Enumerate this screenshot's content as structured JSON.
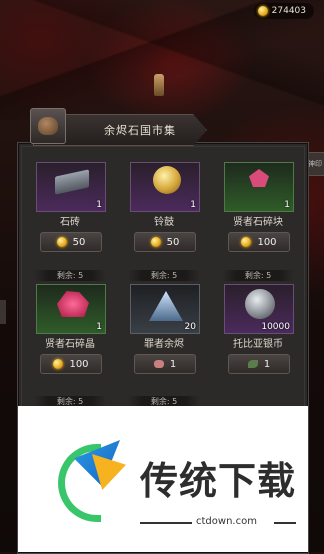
{
  "header": {
    "currency_amount": "274403",
    "currency_icon": "gold-coin-icon"
  },
  "side_tab": {
    "label": "神印"
  },
  "panel": {
    "title": "余烬石国市集",
    "shop_icon": "money-bag-icon"
  },
  "items": [
    {
      "remaining": "",
      "name": "石砖",
      "qty": "1",
      "price": "50",
      "price_icon": "gold-coin-icon",
      "art": "brick-icon"
    },
    {
      "remaining": "",
      "name": "铃鼓",
      "qty": "1",
      "price": "50",
      "price_icon": "gold-coin-icon",
      "art": "bell-icon"
    },
    {
      "remaining": "",
      "name": "贤者石碎块",
      "qty": "1",
      "price": "100",
      "price_icon": "gold-coin-icon",
      "art": "shard-icon"
    },
    {
      "remaining": "剩余: 5",
      "name": "贤者石碎晶",
      "qty": "1",
      "price": "100",
      "price_icon": "gold-coin-icon",
      "art": "crystal-icon"
    },
    {
      "remaining": "剩余: 5",
      "name": "罪者余烬",
      "qty": "20",
      "price": "1",
      "price_icon": "gem-icon",
      "art": "ember-icon"
    },
    {
      "remaining": "剩余: 5",
      "name": "托比亚银币",
      "qty": "10000",
      "price": "1",
      "price_icon": "leaf-icon",
      "art": "silver-coin-icon"
    },
    {
      "remaining": "剩余: 5",
      "name": "",
      "qty": "",
      "price": "",
      "price_icon": "",
      "art": ""
    },
    {
      "remaining": "剩余: 5",
      "name": "",
      "qty": "",
      "price": "",
      "price_icon": "",
      "art": ""
    }
  ],
  "watermark": {
    "title": "传统下载",
    "url": "ctdown.com"
  }
}
